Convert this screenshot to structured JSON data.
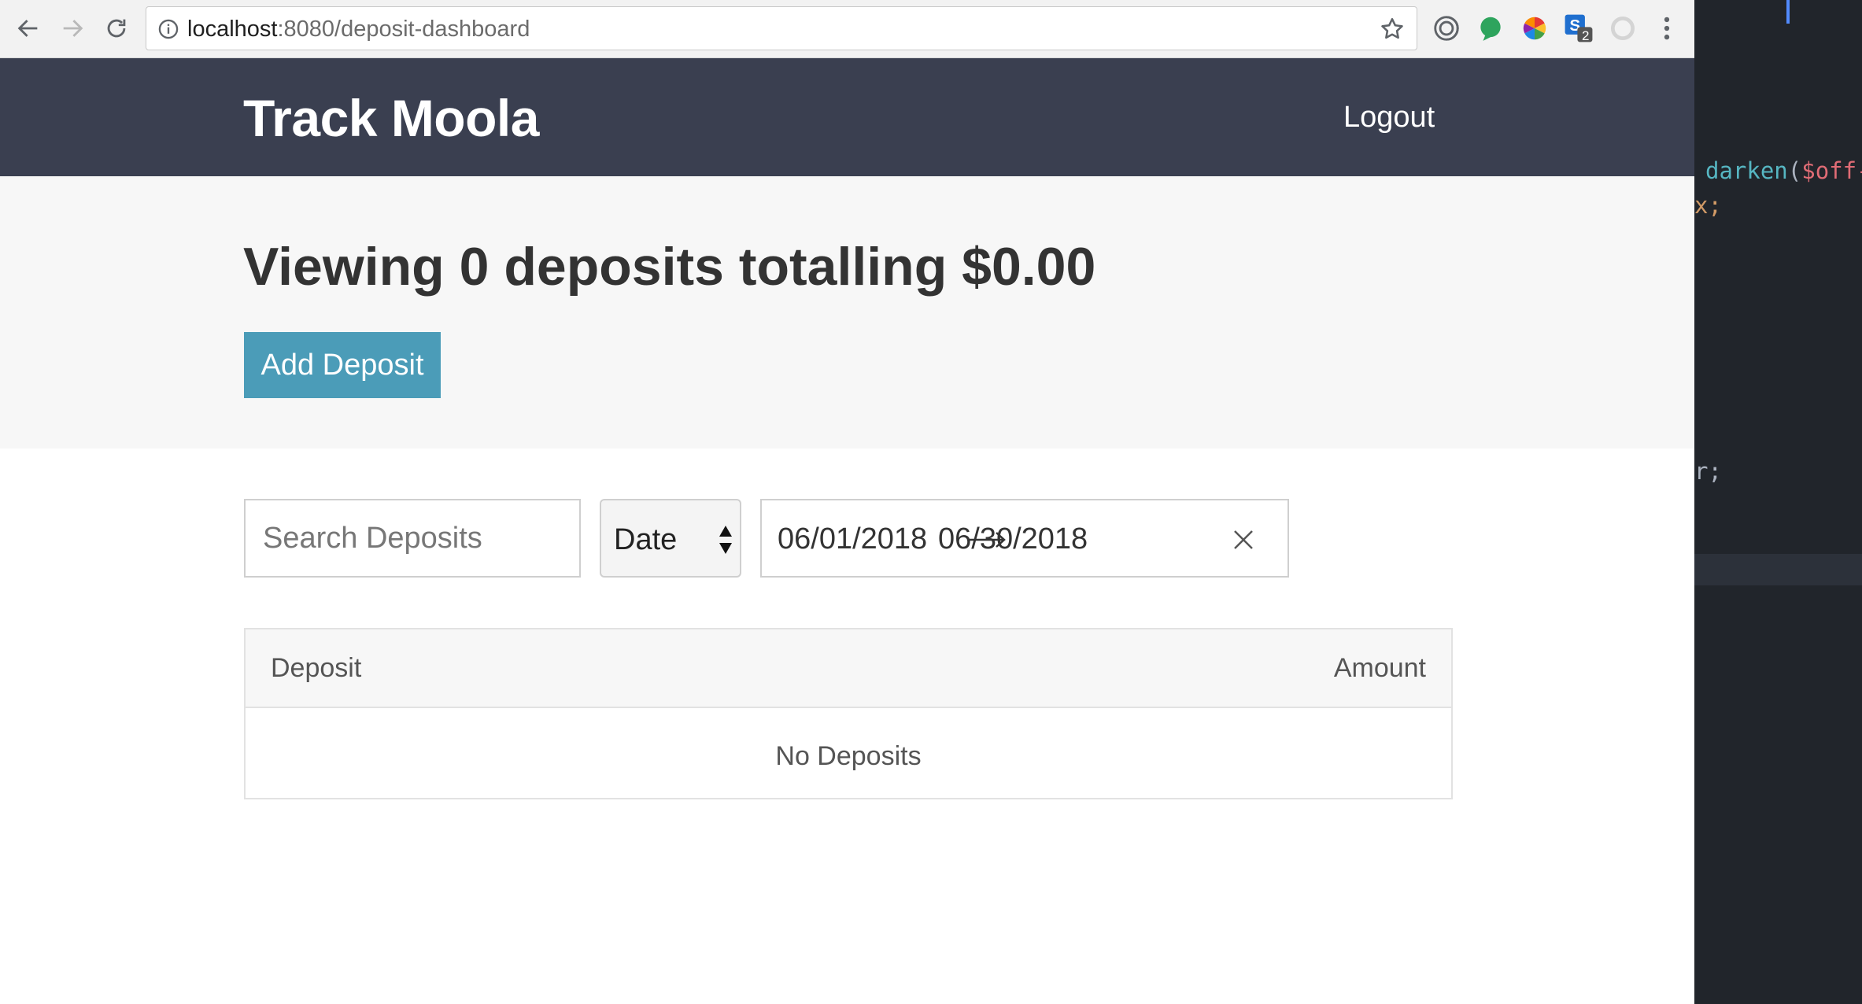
{
  "browser": {
    "url_host": "localhost",
    "url_rest": ":8080/deposit-dashboard",
    "extension_badge": "2"
  },
  "editor": {
    "line1_fn": "darken",
    "line1_paren": "(",
    "line1_var": "$off-",
    "line2": "x;",
    "line3": "r;"
  },
  "header": {
    "brand": "Track Moola",
    "logout_label": "Logout"
  },
  "summary": {
    "prefix": "Viewing",
    "count": "0",
    "middle": "deposits totalling",
    "total": "$0.00",
    "add_button_label": "Add Deposit"
  },
  "filters": {
    "search_placeholder": "Search Deposits",
    "sort_value": "Date",
    "start_date": "06/01/2018",
    "end_date": "06/30/2018"
  },
  "table": {
    "columns": [
      "Deposit",
      "Amount"
    ],
    "empty_message": "No Deposits"
  }
}
